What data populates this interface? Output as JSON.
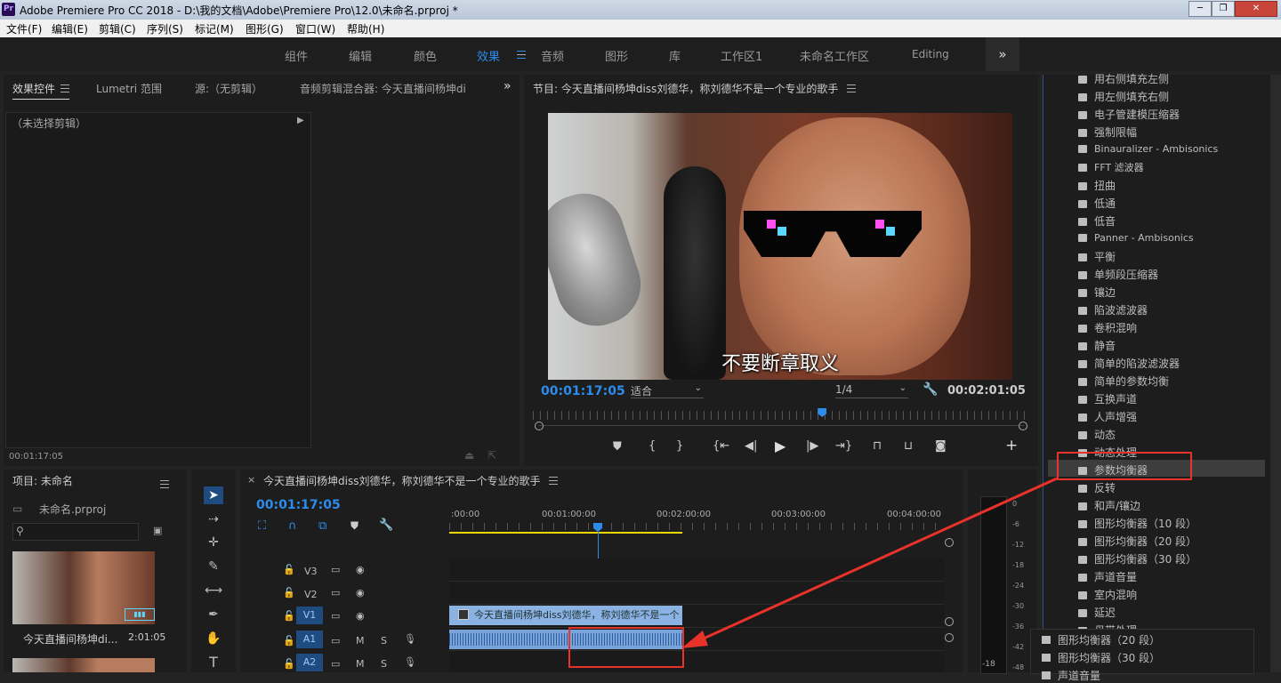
{
  "window": {
    "title": "Adobe Premiere Pro CC 2018 - D:\\我的文档\\Adobe\\Premiere Pro\\12.0\\未命名.prproj *"
  },
  "menu": [
    "文件(F)",
    "编辑(E)",
    "剪辑(C)",
    "序列(S)",
    "标记(M)",
    "图形(G)",
    "窗口(W)",
    "帮助(H)"
  ],
  "workspaces": [
    "组件",
    "编辑",
    "颜色",
    "效果",
    "音频",
    "图形",
    "库",
    "工作区1",
    "未命名工作区",
    "Editing"
  ],
  "effect_controls": {
    "tabs": [
      "效果控件",
      "Lumetri 范围",
      "源:（无剪辑）",
      "音频剪辑混合器: 今天直播间杨坤di"
    ],
    "no_clip": "（未选择剪辑）",
    "timecode": "00:01:17:05"
  },
  "program": {
    "title": "节目: 今天直播间杨坤diss刘德华，称刘德华不是一个专业的歌手",
    "subtitle": "不要断章取义",
    "timecode": "00:01:17:05",
    "fit": "适合",
    "resolution": "1/4",
    "duration": "00:02:01:05",
    "playhead_pct": 58.5
  },
  "project": {
    "title": "项目: 未命名",
    "file": "未命名.prproj",
    "clip_name": "今天直播间杨坤di...",
    "clip_duration": "2:01:05"
  },
  "timeline": {
    "title": "今天直播间杨坤diss刘德华，称刘德华不是一个专业的歌手",
    "timecode": "00:01:17:05",
    "ruler": [
      ":00:00",
      "00:01:00:00",
      "00:02:00:00",
      "00:03:00:00",
      "00:04:00:00"
    ],
    "tracks": [
      "V3",
      "V2",
      "V1",
      "A1",
      "A2"
    ],
    "clip_label": "今天直播间杨坤diss刘德华，称刘德华不是一个"
  },
  "meter": [
    "0",
    "-6",
    "-12",
    "-18",
    "-24",
    "-30",
    "-36",
    "-42",
    "-48"
  ],
  "meter_bottom": "-18",
  "effects_list": [
    "用右侧填充左侧",
    "用左侧填充右侧",
    "电子管建模压缩器",
    "强制限幅",
    "Binauralizer - Ambisonics",
    "FFT 滤波器",
    "扭曲",
    "低通",
    "低音",
    "Panner - Ambisonics",
    "平衡",
    "单频段压缩器",
    "镶边",
    "陷波滤波器",
    "卷积混响",
    "静音",
    "简单的陷波滤波器",
    "简单的参数均衡",
    "互换声道",
    "人声增强",
    "动态",
    "动态处理",
    "参数均衡器",
    "反转",
    "和声/镶边",
    "图形均衡器（10 段）",
    "图形均衡器（20 段）",
    "图形均衡器（30 段）",
    "声道音量",
    "室内混响",
    "延迟",
    "母带处理"
  ],
  "drag_tooltip": [
    "图形均衡器（20 段）",
    "图形均衡器（30 段）",
    "声道音量"
  ],
  "colors": {
    "accent": "#2d8ceb",
    "highlight": "#e8322a"
  }
}
